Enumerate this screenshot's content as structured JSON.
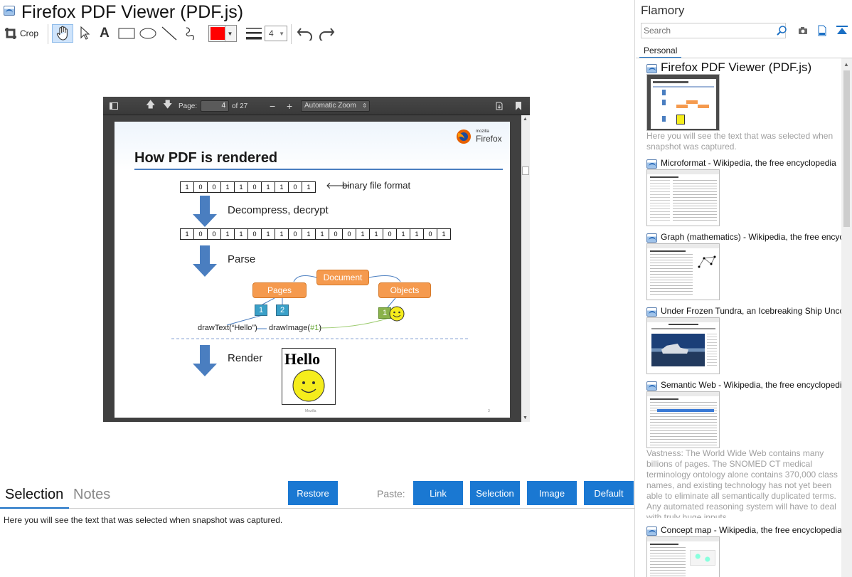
{
  "left": {
    "title": "Firefox PDF Viewer (PDF.js)",
    "toolbar": {
      "crop_label": "Crop",
      "text_tool": "A",
      "color": "#ff0000",
      "line_width": "4"
    },
    "viewer": {
      "page_label": "Page:",
      "page_number": "4",
      "page_total": "of 27",
      "zoom": "Automatic Zoom",
      "slide": {
        "brand": "Firefox",
        "brand_small": "mozilla",
        "title": "How PDF is rendered",
        "bits_short": [
          "1",
          "0",
          "0",
          "1",
          "1",
          "0",
          "1",
          "1",
          "0",
          "1"
        ],
        "bits_long": [
          "1",
          "0",
          "0",
          "1",
          "1",
          "0",
          "1",
          "1",
          "0",
          "1",
          "1",
          "0",
          "0",
          "1",
          "1",
          "0",
          "1",
          "1",
          "0",
          "1"
        ],
        "binary_label": "binary file format",
        "step1": "Decompress, decrypt",
        "step2": "Parse",
        "step3": "Render",
        "document_box": "Document",
        "pages_box": "Pages",
        "objects_box": "Objects",
        "sq1": "1",
        "sq2": "2",
        "sq3": "1",
        "draw_text": "drawText(“Hello”)",
        "draw_image": "drawImage(",
        "draw_image_ref": "#1",
        "draw_image_close": ")",
        "hello": "Hello",
        "footer": "Mozilla",
        "page_no": "3"
      }
    },
    "bottom": {
      "tab_selection": "Selection",
      "tab_notes": "Notes",
      "restore": "Restore",
      "paste_label": "Paste:",
      "paste_link": "Link",
      "paste_selection": "Selection",
      "paste_image": "Image",
      "paste_default": "Default",
      "selection_text": "Here you will see the text that was selected when snapshot was captured."
    }
  },
  "right": {
    "app_name": "Flamory",
    "search_placeholder": "Search",
    "tab": "Personal",
    "items": [
      {
        "title": "Firefox PDF Viewer (PDF.js)",
        "desc": "Here you will see the text that was selected when snapshot was captured."
      },
      {
        "title": "Microformat - Wikipedia, the free encyclopedia"
      },
      {
        "title": "Graph (mathematics) - Wikipedia, the free encyclopedia"
      },
      {
        "title": "Under Frozen Tundra, an Icebreaking Ship Uncovers"
      },
      {
        "title": "Semantic Web - Wikipedia, the free encyclopedia",
        "desc": "Vastness: The World Wide Web contains many billions of pages. The SNOMED CT medical terminology ontology alone contains 370,000 class names, and existing technology has not yet been able to eliminate all semantically duplicated terms. Any automated reasoning system will have to deal with truly huge inputs."
      },
      {
        "title": "Concept map - Wikipedia, the free encyclopedia"
      }
    ]
  },
  "colors": {
    "accent": "#1a78d2",
    "orange": "#f59a4e",
    "teal": "#3aa0c8"
  }
}
